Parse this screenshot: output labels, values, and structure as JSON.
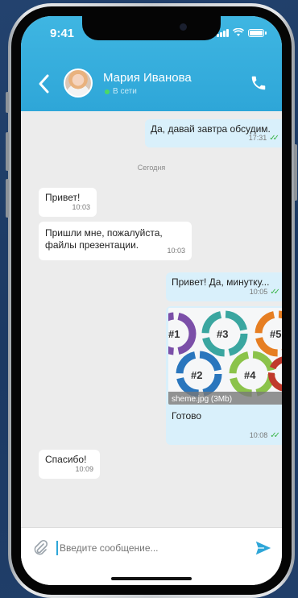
{
  "status_bar": {
    "time": "9:41"
  },
  "contact": {
    "name": "Мария Иванова",
    "status": "В сети"
  },
  "messages": [
    {
      "dir": "out",
      "text": "Да, давай завтра обсудим.",
      "time": "17:31"
    },
    {
      "dir": "in",
      "text": "Привет!",
      "time": "10:03"
    },
    {
      "dir": "in",
      "text": "Пришли мне, пожалуйста, файлы презентации.",
      "time": "10:03"
    },
    {
      "dir": "out",
      "text": "Привет! Да, минутку...",
      "time": "10:05"
    },
    {
      "dir": "out",
      "text": "Готово",
      "time": "10:08",
      "attachment": "sheme.jpg (3Mb)"
    },
    {
      "dir": "in",
      "text": "Спасибо!",
      "time": "10:09"
    }
  ],
  "day_separator": "Сегодня",
  "image_labels": [
    "#1",
    "#2",
    "#3",
    "#4",
    "#5"
  ],
  "composer": {
    "placeholder": "Введите сообщение..."
  },
  "colors": {
    "header": "#2ea6d8",
    "outgoing": "#d9f0fb",
    "incoming": "#ffffff",
    "online": "#4cd964"
  },
  "icons": [
    "back-chevron-icon",
    "phone-icon",
    "paperclip-icon",
    "send-icon",
    "double-check-icon"
  ]
}
